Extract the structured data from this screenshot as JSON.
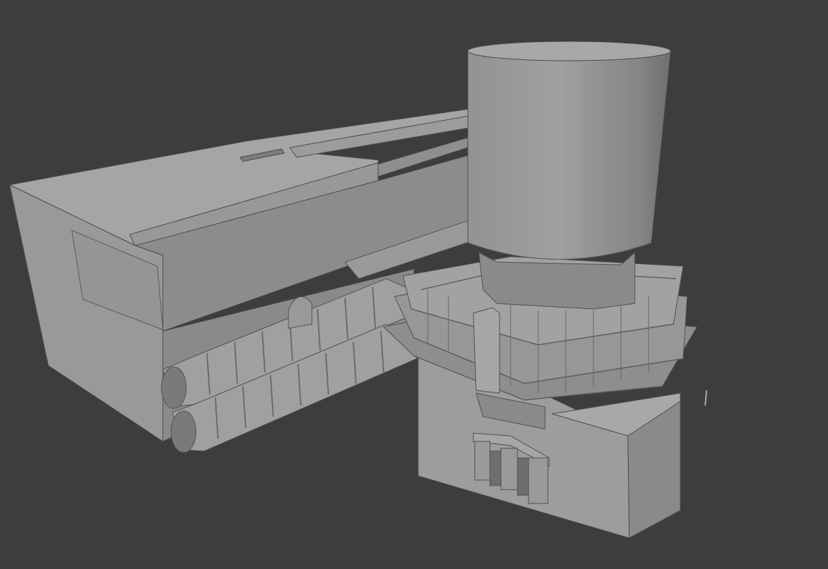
{
  "viewport": {
    "colors": {
      "background": "#3d3d3d",
      "surface_light": "#a3a3a3",
      "surface_mid": "#8f8f8f",
      "surface_dark": "#747474",
      "surface_shadow": "#5c5c5c",
      "edge": "#4a4a4a"
    }
  },
  "scene": {
    "objects": [
      "cylinder-tank",
      "long-block-building",
      "twin-arched-tunnels",
      "tower-structure",
      "base-block",
      "gate-portal"
    ]
  }
}
